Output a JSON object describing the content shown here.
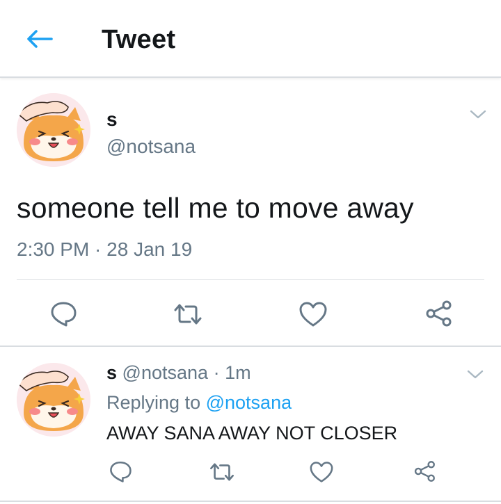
{
  "header": {
    "title": "Tweet",
    "back_icon": "arrow-left-icon",
    "accent": "#1da1f2"
  },
  "tweet": {
    "name": "s",
    "handle": "@notsana",
    "text": "someone tell me to move away",
    "timestamp": "2:30 PM · 28 Jan 19",
    "actions": [
      "reply-icon",
      "retweet-icon",
      "like-icon",
      "share-icon"
    ]
  },
  "reply": {
    "name": "s",
    "handle": "@notsana",
    "separator": "·",
    "time": "1m",
    "replying_prefix": "Replying to",
    "replying_handle": "@notsana",
    "text": "AWAY SANA AWAY NOT CLOSER",
    "actions": [
      "reply-icon",
      "retweet-icon",
      "like-icon",
      "share-icon"
    ]
  },
  "colors": {
    "text": "#14171a",
    "secondary": "#657786",
    "link": "#1da1f2",
    "divider": "#d9dde1"
  }
}
